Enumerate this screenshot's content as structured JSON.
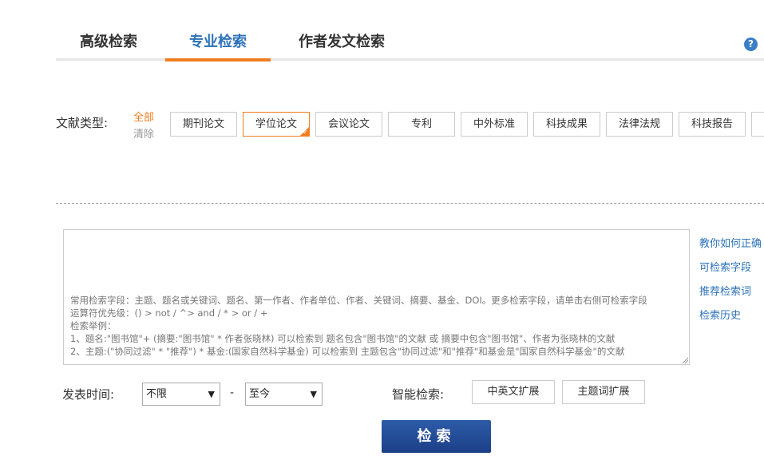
{
  "tabs": [
    {
      "label": "高级检索"
    },
    {
      "label": "专业检索"
    },
    {
      "label": "作者发文检索"
    }
  ],
  "help_icon": "question-icon",
  "help_cut_text": "?",
  "doc_types": {
    "label": "文献类型:",
    "all_label": "全部",
    "clear_label": "清除",
    "items": [
      "期刊论文",
      "学位论文",
      "会议论文",
      "专利",
      "中外标准",
      "科技成果",
      "法律法规",
      "科技报告"
    ],
    "selected": "学位论文"
  },
  "query": {
    "hint_lines": [
      "常用检索字段：主题、题名或关键词、题名、第一作者、作者单位、作者、关键词、摘要、基金、DOI。更多检索字段，请单击右侧可检索字段",
      "运算符优先级：() > not / ^> and / * > or / +",
      "检索举例：",
      "1、题名:\"图书馆\"+ (摘要:\"图书馆\" * 作者张晓林) 可以检索到 题名包含\"图书馆\"的文献 或 摘要中包含\"图书馆\"、作者为张晓林的文献",
      "2、主题:(\"协同过滤\" * \"推荐\") * 基金:(国家自然科学基金) 可以检索到 主题包含\"协同过滤\"和\"推荐\"和基金是\"国家自然科学基金\"的文献"
    ]
  },
  "side_links": [
    "教你如何正确",
    "可检索字段",
    "推荐检索词",
    "检索历史"
  ],
  "date": {
    "label": "发表时间:",
    "from_value": "不限",
    "separator": "-",
    "to_value": "至今"
  },
  "smart": {
    "label": "智能检索:",
    "buttons": [
      "中英文扩展",
      "主题词扩展"
    ]
  },
  "search_button": "检索",
  "colors": {
    "accent": "#f07d1e",
    "link": "#2c72b8",
    "button": "#1c3f87"
  }
}
